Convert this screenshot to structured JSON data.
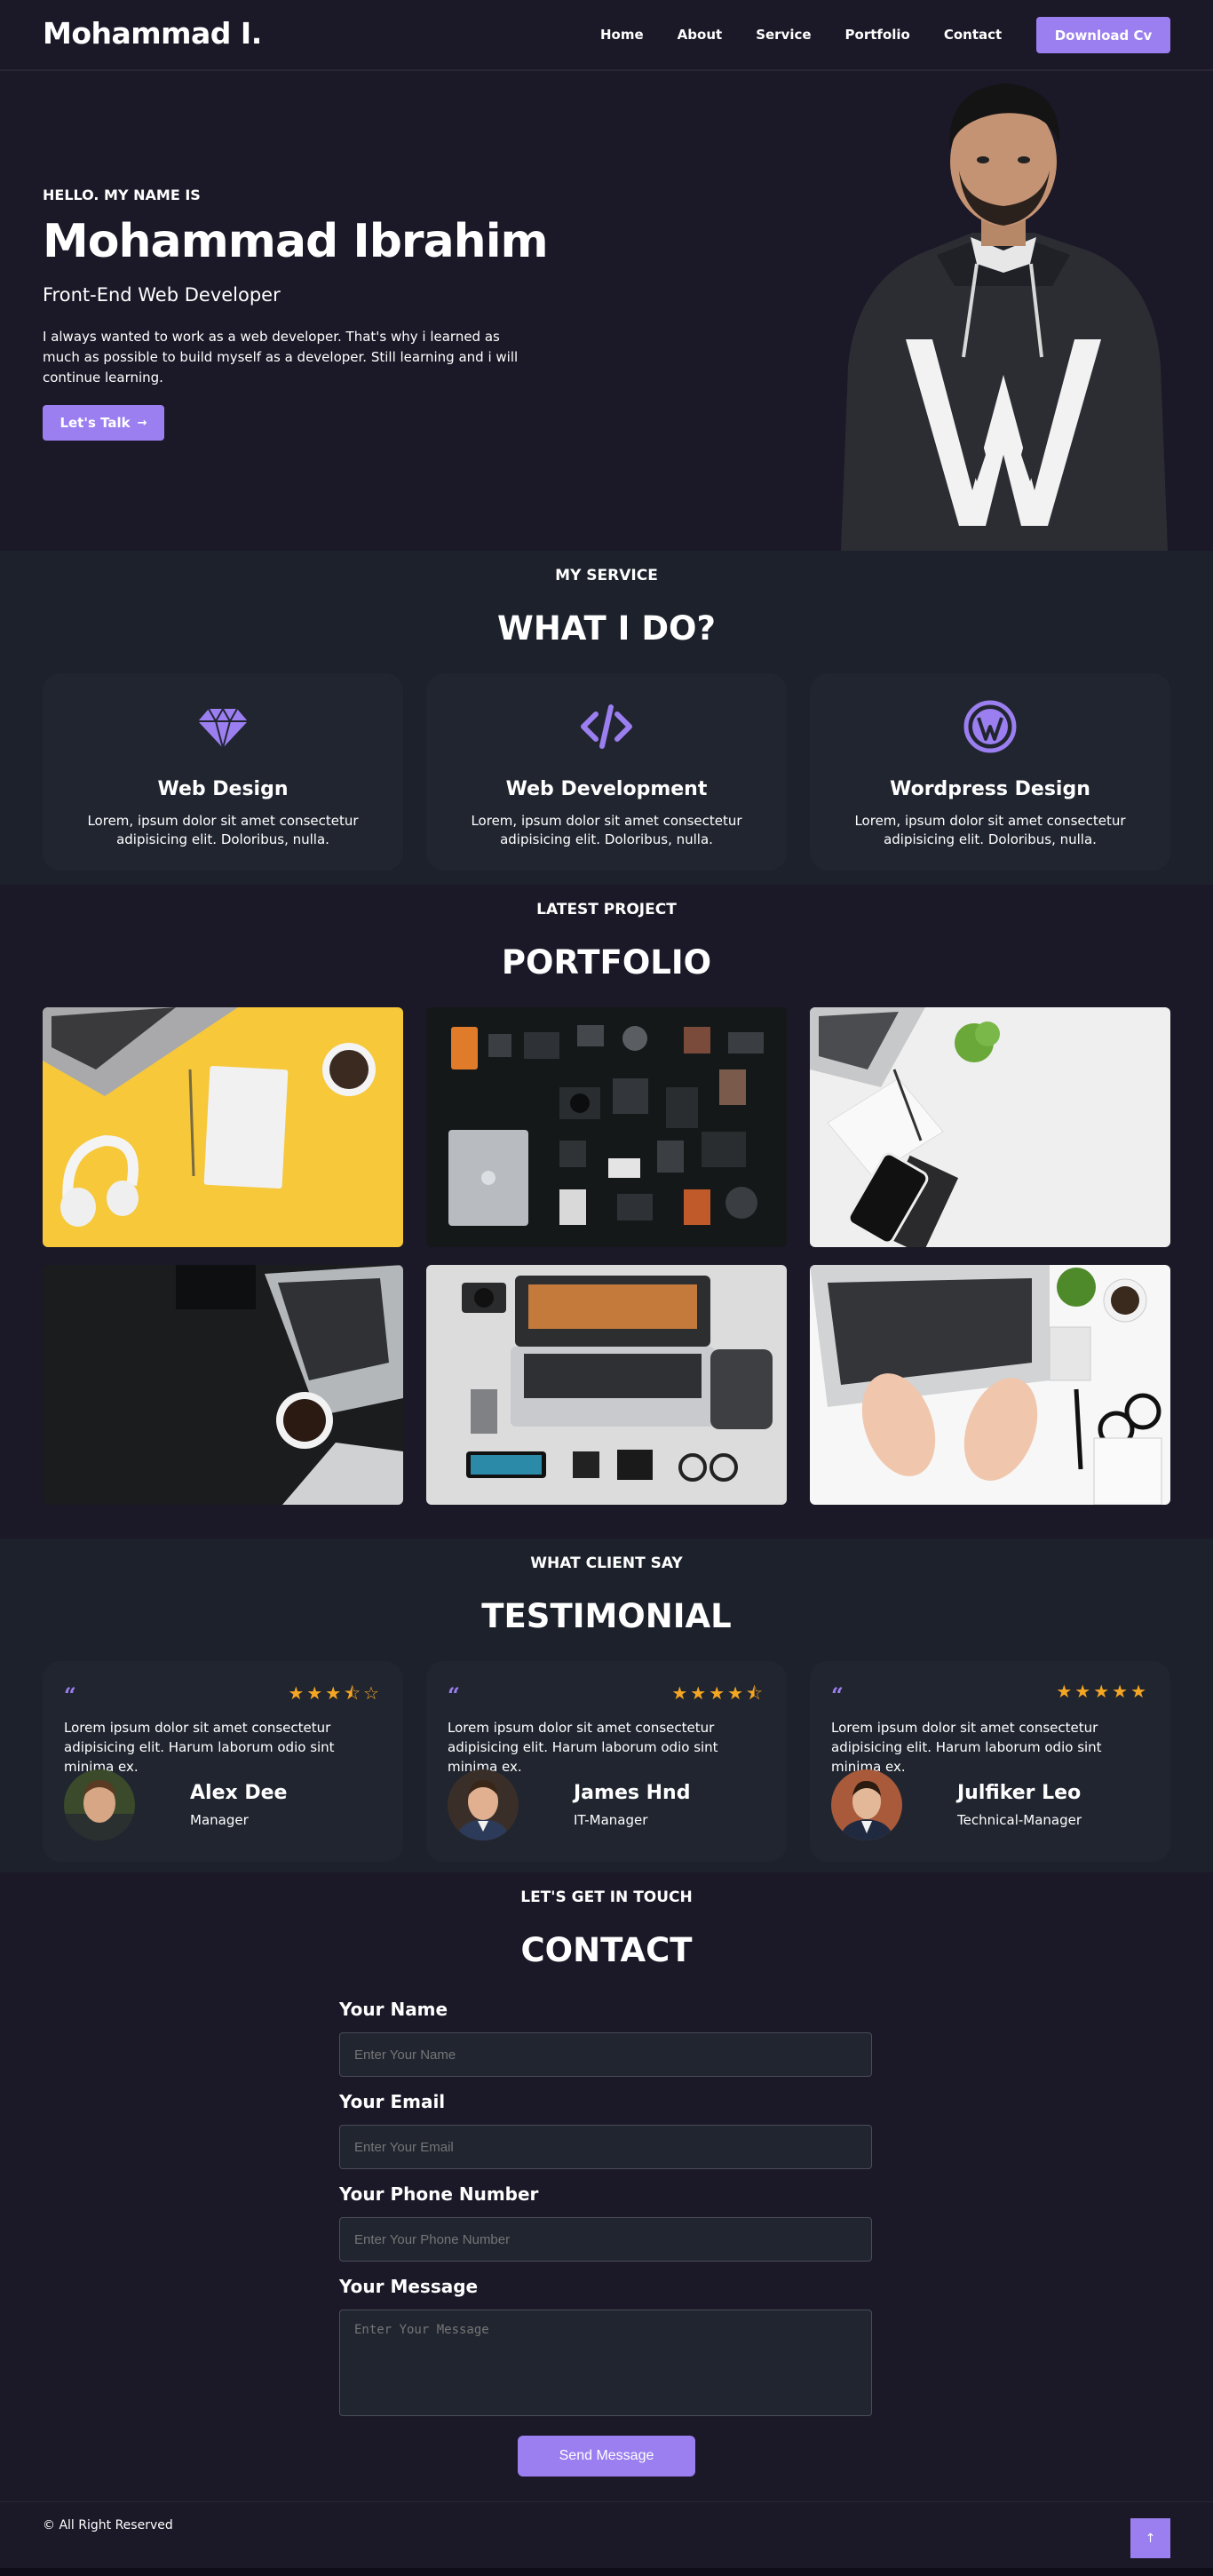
{
  "nav": {
    "logo": "Mohammad I.",
    "links": [
      "Home",
      "About",
      "Service",
      "Portfolio",
      "Contact"
    ],
    "cta": "Download Cv"
  },
  "hero": {
    "greeting": "HELLO. MY NAME IS",
    "name": "Mohammad Ibrahim",
    "role": "Front-End Web Developer",
    "description": "I always wanted to work as a web developer. That's why i learned as much as possible to build myself as a developer. Still learning and i will continue learning.",
    "cta": "Let's Talk",
    "cta_icon": "arrow-right-icon"
  },
  "services": {
    "sub": "MY SERVICE",
    "heading": "WHAT I DO?",
    "items": [
      {
        "icon": "diamond-icon",
        "title": "Web Design",
        "desc": "Lorem, ipsum dolor sit amet consectetur adipisicing elit. Doloribus, nulla."
      },
      {
        "icon": "code-icon",
        "title": "Web Development",
        "desc": "Lorem, ipsum dolor sit amet consectetur adipisicing elit. Doloribus, nulla."
      },
      {
        "icon": "wordpress-icon",
        "title": "Wordpress Design",
        "desc": "Lorem, ipsum dolor sit amet consectetur adipisicing elit. Doloribus, nulla."
      }
    ]
  },
  "portfolio": {
    "sub": "LATEST PROJECT",
    "heading": "PORTFOLIO"
  },
  "testimonials": {
    "sub": "WHAT CLIENT SAY",
    "heading": "TESTIMONIAL",
    "items": [
      {
        "text": "Lorem ipsum dolor sit amet consectetur adipisicing elit. Harum laborum odio sint minima ex.",
        "name": "Alex Dee",
        "role": "Manager",
        "rating": 3.5,
        "stars": "★★★⯪☆"
      },
      {
        "text": "Lorem ipsum dolor sit amet consectetur adipisicing elit. Harum laborum odio sint minima ex.",
        "name": "James Hnd",
        "role": "IT-Manager",
        "rating": 4.5,
        "stars": "★★★★⯪"
      },
      {
        "text": "Lorem ipsum dolor sit amet consectetur adipisicing elit. Harum laborum odio sint minima ex.",
        "name": "Julfiker Leo",
        "role": "Technical-Manager",
        "rating": 5,
        "stars": "★★★★★"
      }
    ]
  },
  "contact": {
    "sub": "LET'S GET IN TOUCH",
    "heading": "CONTACT",
    "fields": [
      {
        "label": "Your Name",
        "placeholder": "Enter Your Name"
      },
      {
        "label": "Your Email",
        "placeholder": "Enter Your Email"
      },
      {
        "label": "Your Phone Number",
        "placeholder": "Enter Your Phone Number"
      },
      {
        "label": "Your Message",
        "placeholder": "Enter Your Message"
      }
    ],
    "submit": "Send Message"
  },
  "footer": {
    "copyright": "© All Right Reserved",
    "top_icon": "arrow-up-icon"
  },
  "colors": {
    "accent": "#9b7ff0",
    "background": "#1b1827",
    "card": "#212530",
    "star": "#f5a623"
  }
}
